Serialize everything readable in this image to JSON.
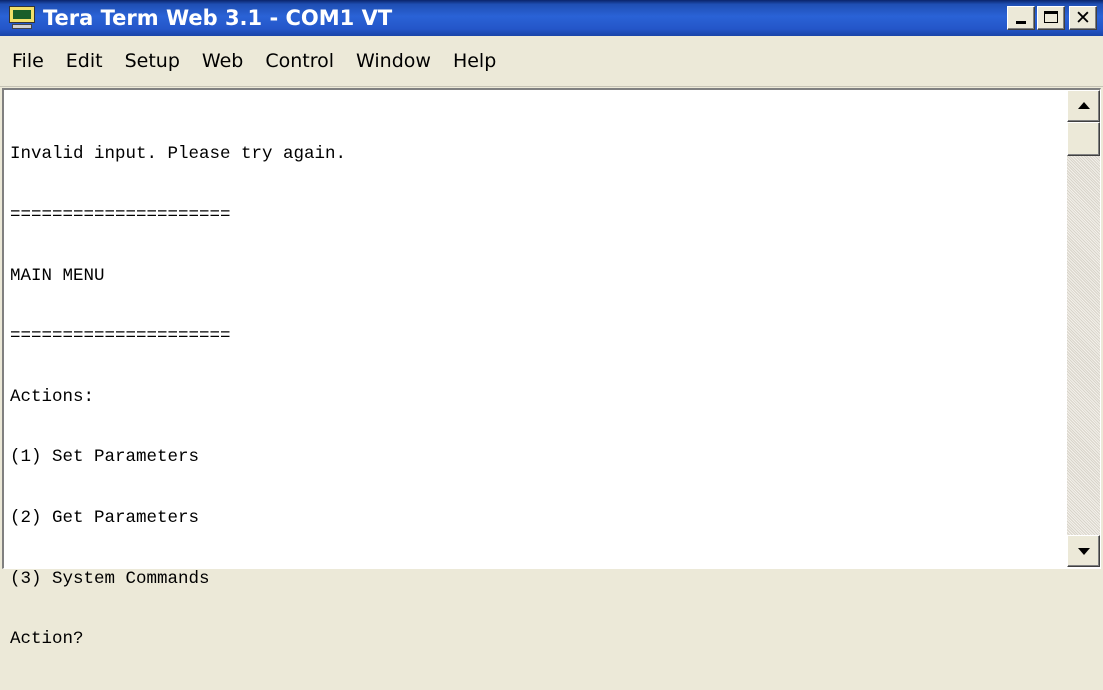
{
  "window": {
    "title": "Tera Term Web 3.1 - COM1 VT",
    "icon": "tera-term-vt-icon"
  },
  "menu": {
    "items": [
      {
        "label": "File"
      },
      {
        "label": "Edit"
      },
      {
        "label": "Setup"
      },
      {
        "label": "Web"
      },
      {
        "label": "Control"
      },
      {
        "label": "Window"
      },
      {
        "label": "Help"
      }
    ]
  },
  "terminal": {
    "lines": [
      "Invalid input. Please try again.",
      "=====================",
      "MAIN MENU",
      "=====================",
      "Actions:",
      "(1) Set Parameters",
      "(2) Get Parameters",
      "(3) System Commands",
      "Action?"
    ]
  },
  "colors": {
    "titlebar": "#2456c9",
    "title_text": "#ffffff",
    "chrome": "#ece9d8",
    "terminal_bg": "#ffffff",
    "terminal_fg": "#000000"
  }
}
